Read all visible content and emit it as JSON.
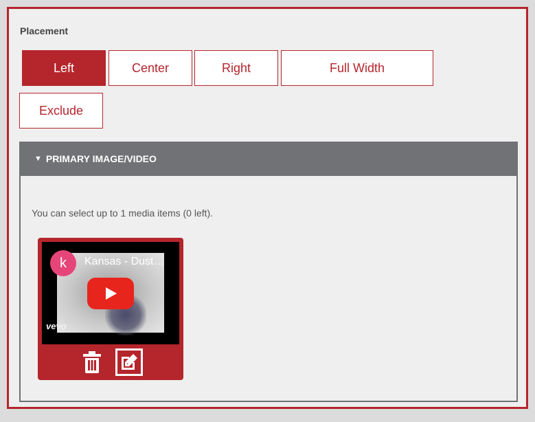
{
  "placement": {
    "label": "Placement",
    "options": [
      {
        "label": "Left",
        "selected": true
      },
      {
        "label": "Center",
        "selected": false
      },
      {
        "label": "Right",
        "selected": false
      },
      {
        "label": "Full Width",
        "selected": false
      },
      {
        "label": "Exclude",
        "selected": false
      }
    ]
  },
  "primary_media": {
    "header": "PRIMARY IMAGE/VIDEO",
    "help_text": "You can select up to 1 media items (0 left).",
    "item": {
      "avatar_letter": "k",
      "title": "Kansas - Dust…",
      "watermark": "vevo",
      "actions": {
        "delete_icon": "trash-icon",
        "edit_icon": "edit-icon"
      }
    }
  },
  "colors": {
    "accent": "#b5252c",
    "header_bg": "#717275",
    "play_red": "#e8251d",
    "avatar_pink": "#e6457a"
  }
}
